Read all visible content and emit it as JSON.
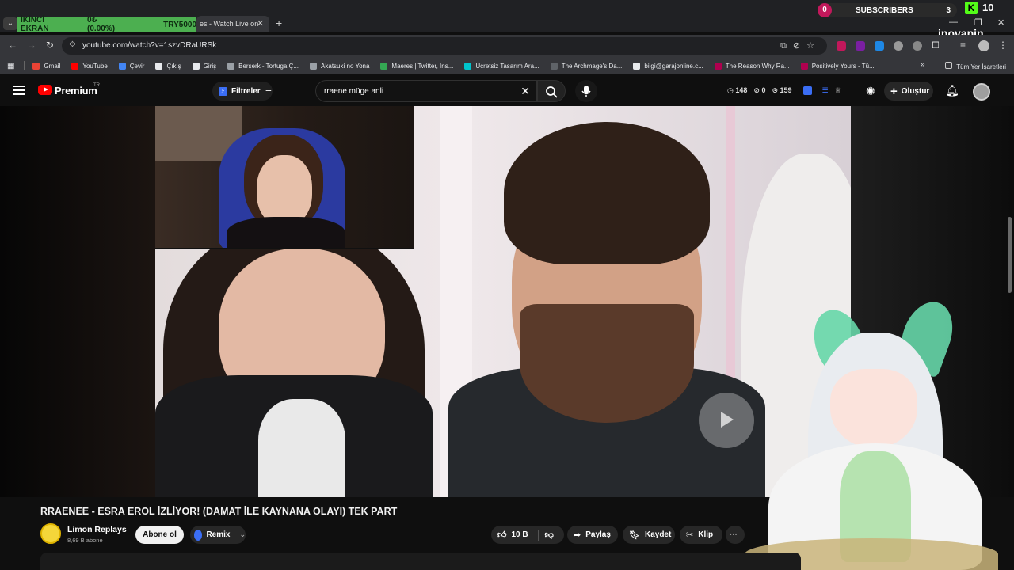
{
  "browser": {
    "overlay": {
      "left_label": "İKİNCİ EKRAN",
      "middle_label": "0₺ (0.00%)",
      "right_label": "TRY5000"
    },
    "tab_title": "es - Watch Live on",
    "url": "youtube.com/watch?v=1szvDRaURSk",
    "subscribers": {
      "count_left": "0",
      "label": "SUBSCRIBERS",
      "count_right": "3"
    },
    "kick": {
      "icon": "K",
      "count": "10"
    },
    "watermark": "inovapin",
    "bookmarks": [
      {
        "label": "Gmail",
        "color": "#ea4335"
      },
      {
        "label": "YouTube",
        "color": "#ff0000"
      },
      {
        "label": "Çevir",
        "color": "#4285f4"
      },
      {
        "label": "Çıkış",
        "color": "#e8eaed"
      },
      {
        "label": "Giriş",
        "color": "#e8eaed"
      },
      {
        "label": "Berserk - Tortuga Ç...",
        "color": "#9aa0a6"
      },
      {
        "label": "Akatsuki no Yona",
        "color": "#9aa0a6"
      },
      {
        "label": "Maeres | Twitter, Ins...",
        "color": "#34a853"
      },
      {
        "label": "Ücretsiz Tasarım Ara...",
        "color": "#00c4cc"
      },
      {
        "label": "The Archmage's Da...",
        "color": "#5f6368"
      },
      {
        "label": "bilgi@garajonline.c...",
        "color": "#e8eaed"
      },
      {
        "label": "The Reason Why Ra...",
        "color": "#b0004f"
      },
      {
        "label": "Positively Yours - Tü...",
        "color": "#b0004f"
      }
    ],
    "bookmarks_more": "»",
    "all_bookmarks": "Tüm Yer İşaretleri"
  },
  "youtube": {
    "logo_text": "Premium",
    "region": "TR",
    "filter_label": "Filtreler",
    "search_value": "rraene müge anli",
    "stats": {
      "a": "148",
      "b": "0",
      "c": "159"
    },
    "create_label": "Oluştur"
  },
  "video": {
    "title": "RRAENEE - ESRA EROL İZLİYOR! (DAMAT İLE KAYNANA OLAYI) TEK PART",
    "channel_name": "Limon Replays",
    "channel_subs": "8,69 B abone",
    "subscribe_label": "Abone ol",
    "remix_label": "Remix",
    "like_count": "10 B",
    "share_label": "Paylaş",
    "save_label": "Kaydet",
    "clip_label": "Klip",
    "more_label": "···"
  },
  "colors": {
    "accent": "#ff0000",
    "overlay_green": "#4caf50",
    "kick_green": "#53fc18"
  }
}
